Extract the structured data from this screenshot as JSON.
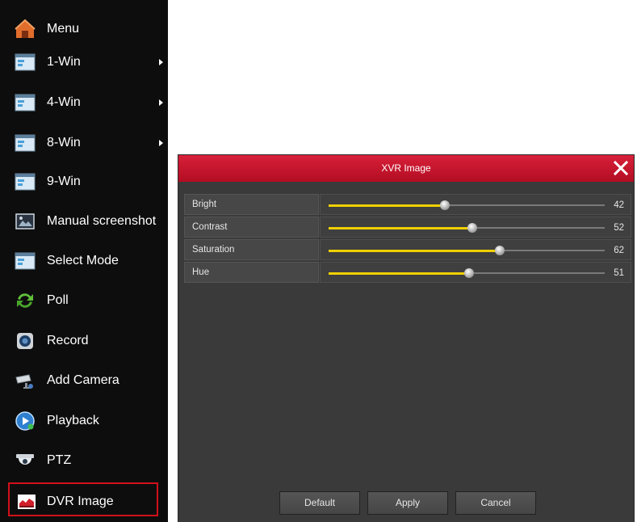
{
  "menu": {
    "items": [
      {
        "label": "Menu",
        "icon": "home-icon",
        "submenu": false
      },
      {
        "label": "1-Win",
        "icon": "window-icon",
        "submenu": true
      },
      {
        "label": "4-Win",
        "icon": "window-icon",
        "submenu": true
      },
      {
        "label": "8-Win",
        "icon": "window-icon",
        "submenu": true
      },
      {
        "label": "9-Win",
        "icon": "window-icon",
        "submenu": false
      },
      {
        "label": "Manual screenshot",
        "icon": "screenshot-icon",
        "submenu": false
      },
      {
        "label": "Select Mode",
        "icon": "window-icon",
        "submenu": false
      },
      {
        "label": "Poll",
        "icon": "poll-icon",
        "submenu": false
      },
      {
        "label": "Record",
        "icon": "record-icon",
        "submenu": false
      },
      {
        "label": "Add Camera",
        "icon": "camera-icon",
        "submenu": false
      },
      {
        "label": "Playback",
        "icon": "playback-icon",
        "submenu": false
      },
      {
        "label": "PTZ",
        "icon": "ptz-icon",
        "submenu": false
      },
      {
        "label": "DVR Image",
        "icon": "image-chart-icon",
        "submenu": false,
        "highlighted": true
      }
    ]
  },
  "dialog": {
    "title": "XVR Image",
    "settings": [
      {
        "name": "Bright",
        "value": "42"
      },
      {
        "name": "Contrast",
        "value": "52"
      },
      {
        "name": "Saturation",
        "value": "62"
      },
      {
        "name": "Hue",
        "value": "51"
      }
    ],
    "buttons": {
      "default": "Default",
      "apply": "Apply",
      "cancel": "Cancel"
    }
  },
  "colors": {
    "header_red": "#c8142e",
    "highlight_border": "#d0101b",
    "slider_fill": "#f0d000"
  }
}
